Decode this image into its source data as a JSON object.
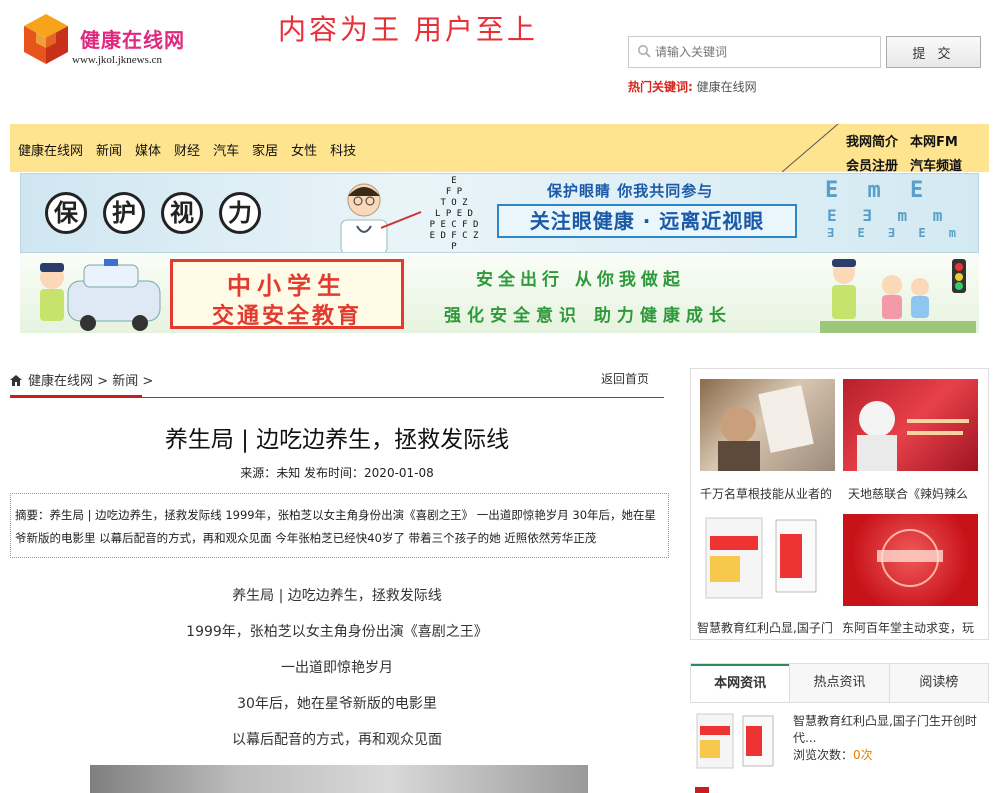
{
  "header": {
    "logo_name": "健康在线网",
    "logo_url": "www.jkol.jknews.cn",
    "slogan": "内容为王 用户至上",
    "search_placeholder": "请输入关键词",
    "search_button": "提 交",
    "hot_label": "热门关键词:",
    "hot_keyword": "健康在线网"
  },
  "nav": {
    "items": [
      "健康在线网",
      "新闻",
      "媒体",
      "财经",
      "汽车",
      "家居",
      "女性",
      "科技"
    ],
    "right_row1": [
      "我网简介",
      "本网FM"
    ],
    "right_row2": [
      "会员注册",
      "汽车频道"
    ]
  },
  "banner1": {
    "chars": [
      "保",
      "护",
      "视",
      "力"
    ],
    "subtitle": "保护眼睛 你我共同参与",
    "title": "关注眼健康 · 远离近视眼"
  },
  "banner2": {
    "title1": "中小学生",
    "title2": "交通安全教育",
    "right1": "安全出行 从你我做起",
    "right2": "强化安全意识 助力健康成长"
  },
  "breadcrumb": {
    "home": "健康在线网",
    "sep1": " > ",
    "section": "新闻",
    "sep2": " >",
    "back": "返回首页"
  },
  "article": {
    "title": "养生局 | 边吃边养生，拯救发际线",
    "meta": "来源：未知 发布时间：2020-01-08",
    "abstract": "摘要：养生局 | 边吃边养生，拯救发际线 1999年，张柏芝以女主角身份出演《喜剧之王》 一出道即惊艳岁月 30年后，她在星爷新版的电影里 以幕后配音的方式，再和观众见面 今年张柏芝已经快40岁了 带着三个孩子的她 近照依然芳华正茂",
    "lines": [
      "养生局 | 边吃边养生，拯救发际线",
      "1999年，张柏芝以女主角身份出演《喜剧之王》",
      "一出道即惊艳岁月",
      "30年后，她在星爷新版的电影里",
      "以幕后配音的方式，再和观众见面"
    ]
  },
  "sidebar": {
    "captions": [
      "千万名草根技能从业者的",
      "天地慈联合《辣妈辣么",
      "智慧教育红利凸显,国子门",
      "东阿百年堂主动求变，玩"
    ],
    "tabs": [
      "本网资讯",
      "热点资讯",
      "阅读榜"
    ],
    "news_title": "智慧教育红利凸显,国子门生开创时代...",
    "views_label": "浏览次数：",
    "views_count": "0次"
  }
}
